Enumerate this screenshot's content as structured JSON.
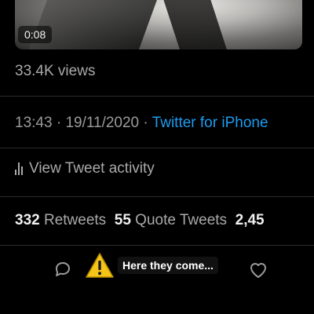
{
  "video": {
    "duration": "0:08"
  },
  "tweet": {
    "views": "33.4K views",
    "time": "13:43",
    "date": "19/11/2020",
    "separator": " · ",
    "source": "Twitter for iPhone",
    "activity_label": "View Tweet activity",
    "retweets_count": "332",
    "retweets_label": "Retweets",
    "quote_count": "55",
    "quote_label": "Quote Tweets",
    "likes_count": "2,45"
  },
  "caption": {
    "text": "Here they come..."
  },
  "colors": {
    "accent": "#1d9bf0",
    "warning": "#f5c518",
    "background": "#000000"
  },
  "icons": {
    "reply": "reply-icon",
    "warning": "warning-icon",
    "like": "heart-icon",
    "activity": "bar-chart-icon"
  }
}
